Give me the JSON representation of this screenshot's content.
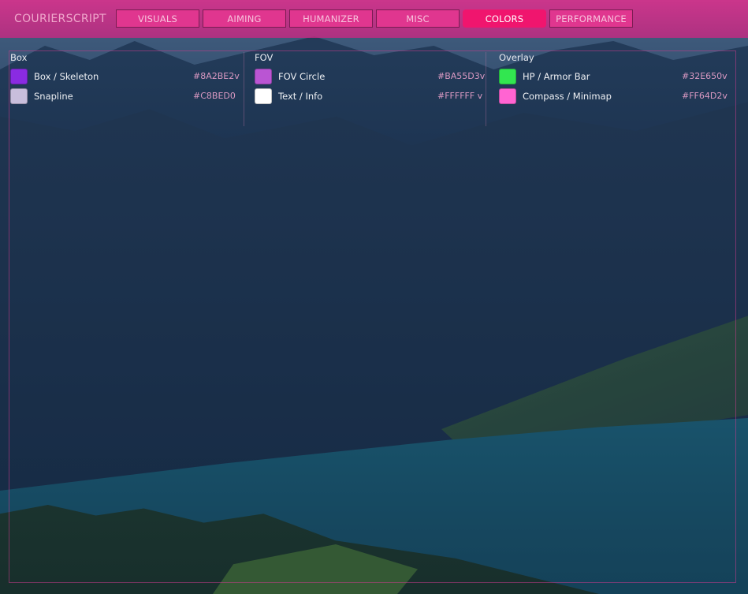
{
  "app": {
    "title": "COURIERSCRIPT"
  },
  "tabs": [
    {
      "label": "VISUALS"
    },
    {
      "label": "AIMING"
    },
    {
      "label": "HUMANIZER"
    },
    {
      "label": "MISC"
    },
    {
      "label": "COLORS",
      "active": true
    },
    {
      "label": "PERFORMANCE"
    }
  ],
  "sections": {
    "box": {
      "title": "Box",
      "items": [
        {
          "label": "Box / Skeleton",
          "hex": "#8A2BE2v",
          "color": "#8A2BE2"
        },
        {
          "label": "Snapline",
          "hex": "#C8BED0",
          "color": "#C8BEDC"
        }
      ]
    },
    "fov": {
      "title": "FOV",
      "items": [
        {
          "label": "FOV Circle",
          "hex": "#BA55D3v",
          "color": "#BA55D3"
        },
        {
          "label": "Text / Info",
          "hex": "#FFFFFF v",
          "color": "#FFFFFF"
        }
      ]
    },
    "overlay": {
      "title": "Overlay",
      "items": [
        {
          "label": "HP / Armor Bar",
          "hex": "#32E650v",
          "color": "#32E650"
        },
        {
          "label": "Compass / Minimap",
          "hex": "#FF64D2v",
          "color": "#FF64D2"
        }
      ]
    }
  },
  "theme": {
    "accent": "#F0156E",
    "tab_bg": "#E0368F",
    "bar_bg": "#D6328C"
  }
}
